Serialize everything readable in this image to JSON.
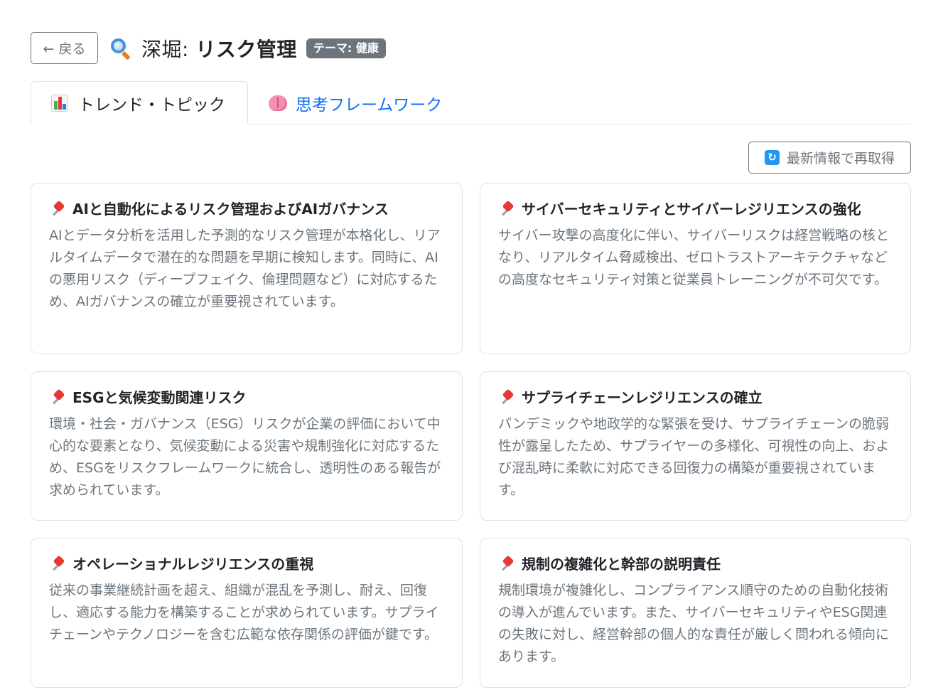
{
  "header": {
    "back_label": "← 戻る",
    "title_prefix": "深堀: ",
    "title_main": "リスク管理",
    "theme_badge": "テーマ: 健康"
  },
  "tabs": [
    {
      "label": "トレンド・トピック",
      "icon": "bar-chart-icon",
      "active": true
    },
    {
      "label": "思考フレームワーク",
      "icon": "brain-icon",
      "active": false
    }
  ],
  "refresh_label": "最新情報で再取得",
  "cards": [
    {
      "title": "AIと自動化によるリスク管理およびAIガバナンス",
      "description": "AIとデータ分析を活用した予測的なリスク管理が本格化し、リアルタイムデータで潜在的な問題を早期に検知します。同時に、AIの悪用リスク（ディープフェイク、倫理問題など）に対応するため、AIガバナンスの確立が重要視されています。"
    },
    {
      "title": "サイバーセキュリティとサイバーレジリエンスの強化",
      "description": "サイバー攻撃の高度化に伴い、サイバーリスクは経営戦略の核となり、リアルタイム脅威検出、ゼロトラストアーキテクチャなどの高度なセキュリティ対策と従業員トレーニングが不可欠です。"
    },
    {
      "title": "ESGと気候変動関連リスク",
      "description": "環境・社会・ガバナンス（ESG）リスクが企業の評価において中心的な要素となり、気候変動による災害や規制強化に対応するため、ESGをリスクフレームワークに統合し、透明性のある報告が求められています。"
    },
    {
      "title": "サプライチェーンレジリエンスの確立",
      "description": "パンデミックや地政学的な緊張を受け、サプライチェーンの脆弱性が露呈したため、サプライヤーの多様化、可視性の向上、および混乱時に柔軟に対応できる回復力の構築が重要視されています。"
    },
    {
      "title": "オペレーショナルレジリエンスの重視",
      "description": "従来の事業継続計画を超え、組織が混乱を予測し、耐え、回復し、適応する能力を構築することが求められています。サプライチェーンやテクノロジーを含む広範な依存関係の評価が鍵です。"
    },
    {
      "title": "規制の複雑化と幹部の説明責任",
      "description": "規制環境が複雑化し、コンプライアンス順守のための自動化技術の導入が進んでいます。また、サイバーセキュリティやESG関連の失敗に対し、経営幹部の個人的な責任が厳しく問われる傾向にあります。"
    }
  ]
}
